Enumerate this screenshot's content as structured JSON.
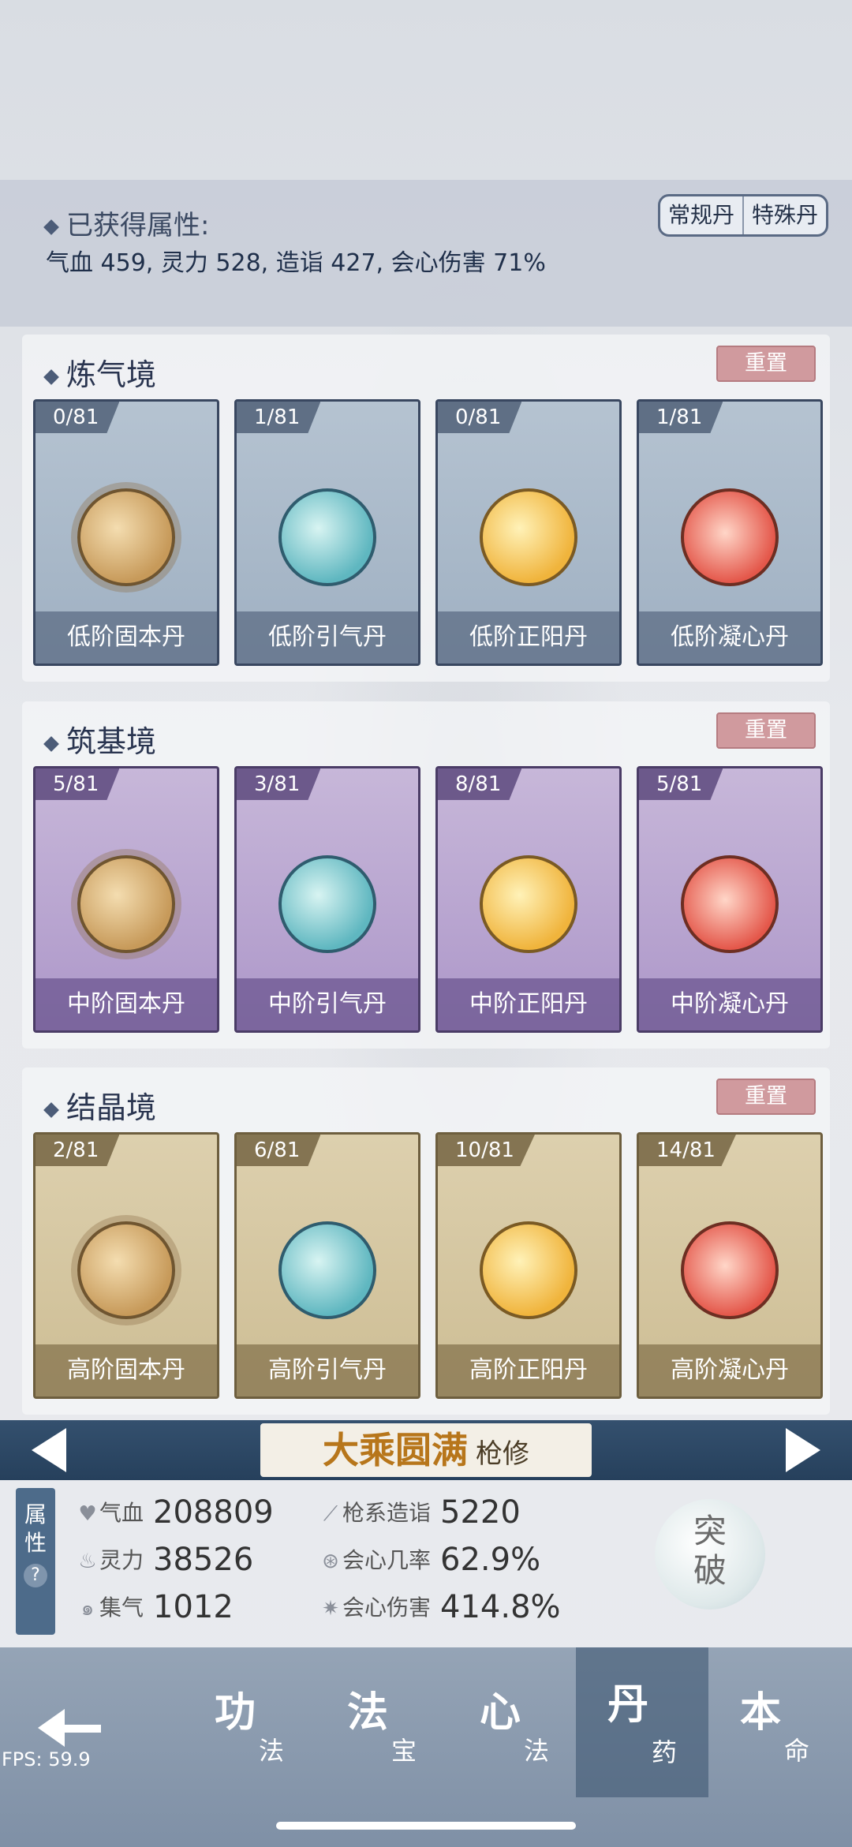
{
  "attributes": {
    "title": "已获得属性:",
    "text": "气血 459, 灵力 528, 造诣 427, 会心伤害 71%",
    "tabs": [
      "常规丹",
      "特殊丹"
    ]
  },
  "reset_label": "重置",
  "sections": [
    {
      "title": "炼气境",
      "cards": [
        {
          "count": "0/81",
          "name": "低阶固本丹",
          "icon": "gu-ben-pill-icon"
        },
        {
          "count": "1/81",
          "name": "低阶引气丹",
          "icon": "yin-qi-pill-icon"
        },
        {
          "count": "0/81",
          "name": "低阶正阳丹",
          "icon": "zheng-yang-pill-icon"
        },
        {
          "count": "1/81",
          "name": "低阶凝心丹",
          "icon": "ning-xin-pill-icon"
        }
      ]
    },
    {
      "title": "筑基境",
      "cards": [
        {
          "count": "5/81",
          "name": "中阶固本丹",
          "icon": "gu-ben-pill-icon"
        },
        {
          "count": "3/81",
          "name": "中阶引气丹",
          "icon": "yin-qi-pill-icon"
        },
        {
          "count": "8/81",
          "name": "中阶正阳丹",
          "icon": "zheng-yang-pill-icon"
        },
        {
          "count": "5/81",
          "name": "中阶凝心丹",
          "icon": "ning-xin-pill-icon"
        }
      ]
    },
    {
      "title": "结晶境",
      "cards": [
        {
          "count": "2/81",
          "name": "高阶固本丹",
          "icon": "gu-ben-pill-icon"
        },
        {
          "count": "6/81",
          "name": "高阶引气丹",
          "icon": "yin-qi-pill-icon"
        },
        {
          "count": "10/81",
          "name": "高阶正阳丹",
          "icon": "zheng-yang-pill-icon"
        },
        {
          "count": "14/81",
          "name": "高阶凝心丹",
          "icon": "ning-xin-pill-icon"
        }
      ]
    }
  ],
  "realm": {
    "name": "大乘圆满",
    "type": "枪修"
  },
  "stats": {
    "tag": "属性",
    "help": "?",
    "hp_label": "气血",
    "hp_value": "208809",
    "mp_label": "灵力",
    "mp_value": "38526",
    "qi_label": "集气",
    "qi_value": "1012",
    "mastery_label": "枪系造诣",
    "mastery_value": "5220",
    "crit_rate_label": "会心几率",
    "crit_rate_value": "62.9%",
    "crit_dmg_label": "会心伤害",
    "crit_dmg_value": "414.8%",
    "breakthrough": "突破"
  },
  "nav": [
    {
      "main": "功",
      "sub": "法"
    },
    {
      "main": "法",
      "sub": "宝"
    },
    {
      "main": "心",
      "sub": "法"
    },
    {
      "main": "丹",
      "sub": "药"
    },
    {
      "main": "本",
      "sub": "命"
    }
  ],
  "fps": "FPS: 59.9"
}
